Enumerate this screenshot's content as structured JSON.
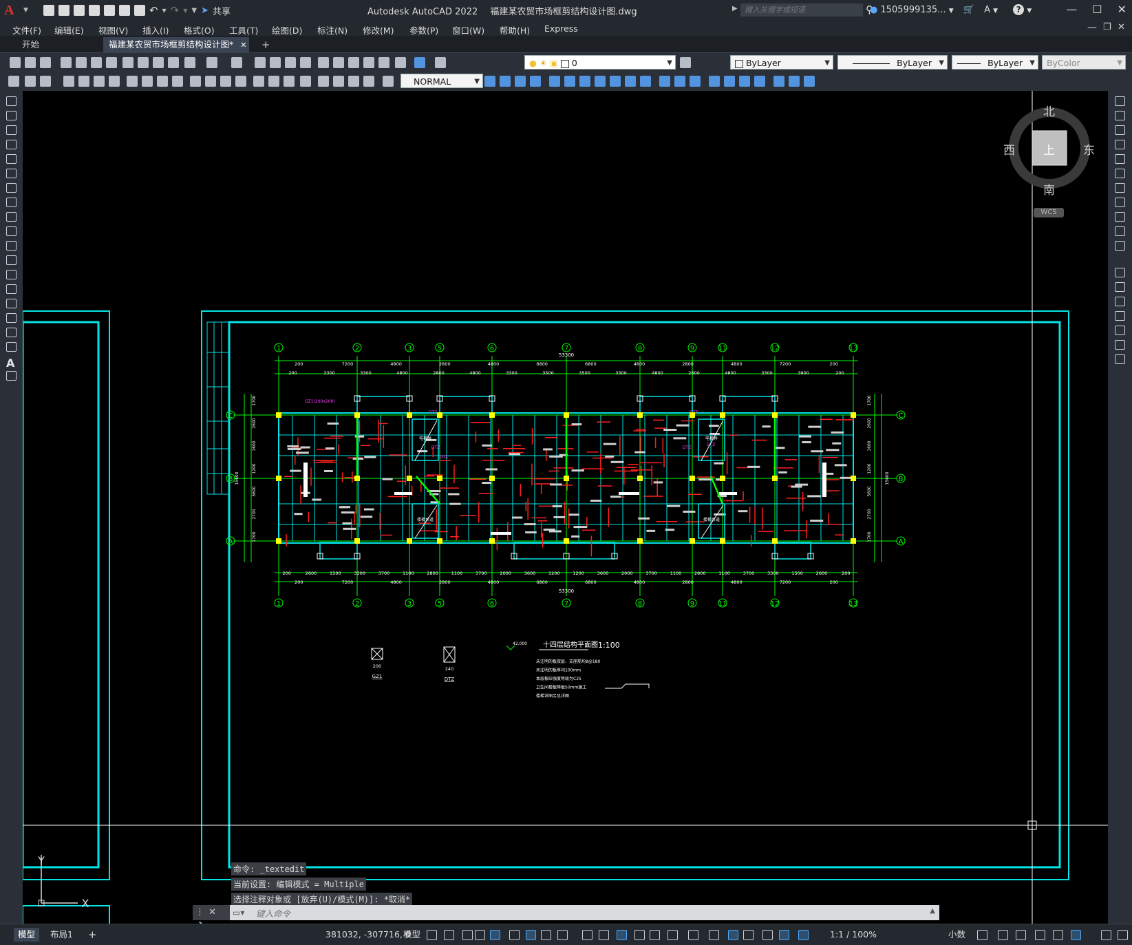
{
  "app": {
    "logo_letter": "A",
    "title": "Autodesk AutoCAD 2022",
    "file_name": "福建某农贸市场框剪结构设计图.dwg",
    "share_label": "共享",
    "search_placeholder": "键入关键字或短语",
    "user": "1505999135...",
    "help": "?"
  },
  "menu": [
    "文件(F)",
    "编辑(E)",
    "视图(V)",
    "插入(I)",
    "格式(O)",
    "工具(T)",
    "绘图(D)",
    "标注(N)",
    "修改(M)",
    "参数(P)",
    "窗口(W)",
    "帮助(H)",
    "Express"
  ],
  "tabs": {
    "start": "开始",
    "active": "福建某农贸市场框剪结构设计图*",
    "close": "✕",
    "add": "+"
  },
  "toolbar": {
    "layer_current": "0",
    "color": "ByLayer",
    "linetype": "ByLayer",
    "lineweight": "ByLayer",
    "plotstyle": "ByColor",
    "dimstyle": "NORMAL"
  },
  "viewcube": {
    "north": "北",
    "south": "南",
    "east": "东",
    "west": "西",
    "top": "上",
    "wcs": "WCS"
  },
  "drawing": {
    "grid_numbers": [
      "1",
      "2",
      "3",
      "5",
      "6",
      "7",
      "8",
      "9",
      "11",
      "12",
      "13"
    ],
    "grid_letters": [
      "C",
      "B",
      "A"
    ],
    "overall_top": "53300",
    "overall_bottom": "53300",
    "top_dims_1": [
      "200",
      "7200",
      "4800",
      "2800",
      "4800",
      "6800",
      "6800",
      "4800",
      "2800",
      "4800",
      "7200",
      "200"
    ],
    "top_dims_2": [
      "200",
      "3300",
      "3300",
      "4800",
      "2800",
      "4800",
      "3300",
      "3500",
      "3500",
      "3300",
      "4800",
      "2800",
      "4800",
      "3300",
      "3900",
      "200"
    ],
    "bottom_dims_1": [
      "200",
      "2600",
      "1500",
      "3300",
      "3700",
      "1100",
      "2800",
      "1100",
      "3700",
      "2000",
      "3600",
      "1200",
      "1200",
      "3600",
      "2000",
      "3700",
      "1100",
      "2800",
      "1100",
      "3700",
      "3300",
      "1500",
      "2600",
      "200"
    ],
    "bottom_dims_2": [
      "200",
      "7200",
      "4800",
      "2800",
      "4800",
      "6800",
      "6800",
      "4800",
      "2800",
      "4800",
      "7200",
      "200"
    ],
    "left_dims": [
      "1700",
      "2600",
      "1600",
      "1200",
      "5600",
      "2700",
      "1700"
    ],
    "left_total": "15600",
    "detail_gz1_label": "GZ1",
    "detail_gz1_dim": "200",
    "detail_dtz_label": "DTZ",
    "detail_dtz_dim": "240",
    "plan_title": "十四层结构平面图",
    "plan_scale": "1:100",
    "level_mark": "42.000",
    "notes": [
      "未注明的板双层、支座筋均8@180",
      "未注明的板厚均100mm",
      "本层板砼强度等级为C25",
      "卫生间楼板降板50mm施工",
      "楼梯详图另见详图"
    ],
    "room_label_elevator": "电梯井",
    "room_label_stair": "楼梯井道",
    "wall_tag": "DTZ",
    "tag_gz1": "GZ1(200x200)"
  },
  "command": {
    "history": [
      "命令: _textedit",
      "当前设置: 编辑模式 = Multiple",
      "选择注释对象或 [放弃(U)/模式(M)]: *取消*"
    ],
    "placeholder": "键入命令"
  },
  "status": {
    "model_tab": "模型",
    "layout_tab": "布局1",
    "add_tab": "+",
    "coords": "381032, -307716, 0",
    "space": "模型",
    "scale": "1:1 / 100%",
    "units": "小数"
  },
  "ucs": {
    "x": "X",
    "y": "Y"
  },
  "colors": {
    "cyan_frame": "#00e5e5",
    "green_axis": "#00ff00",
    "red_beam": "#ff2020",
    "yellow_column": "#ffff00",
    "magenta_text": "#ff40ff",
    "accent_blue": "#4aa8ff"
  }
}
